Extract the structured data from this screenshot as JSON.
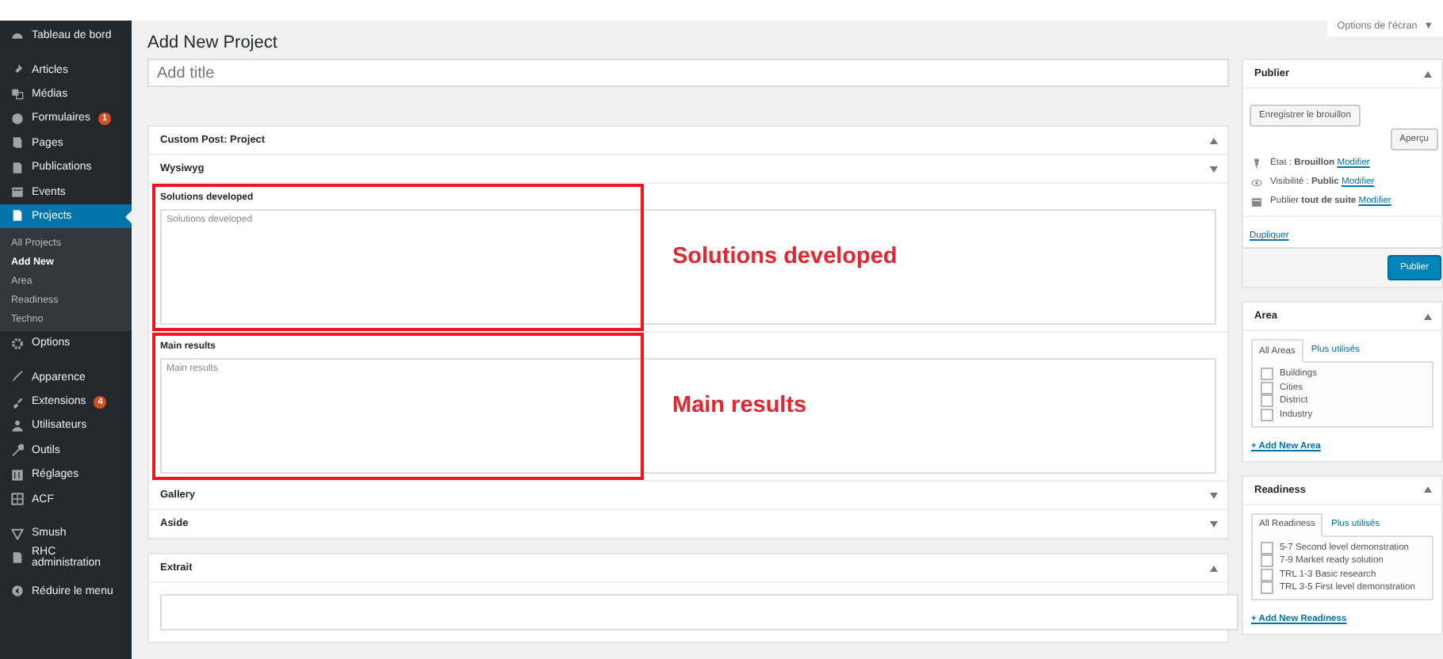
{
  "sidebar": {
    "groups": [
      [
        {
          "label": "Tableau de bord",
          "selected": false
        }
      ],
      [
        {
          "label": "Articles",
          "selected": false
        },
        {
          "label": "Médias",
          "selected": false
        },
        {
          "label": "Formulaires",
          "badge": "1",
          "selected": false
        },
        {
          "label": "Pages",
          "selected": false
        },
        {
          "label": "Publications",
          "selected": false
        },
        {
          "label": "Events",
          "selected": false
        },
        {
          "label": "Projects",
          "selected": true,
          "children": [
            {
              "label": "All Projects",
              "selected": false
            },
            {
              "label": "Add New",
              "selected": true
            },
            {
              "label": "Area",
              "selected": false
            },
            {
              "label": "Readiness",
              "selected": false
            },
            {
              "label": "Techno",
              "selected": false
            }
          ]
        },
        {
          "label": "Options",
          "selected": false
        }
      ],
      [
        {
          "label": "Apparence",
          "selected": false
        },
        {
          "label": "Extensions",
          "badge": "4",
          "selected": false
        },
        {
          "label": "Utilisateurs",
          "selected": false
        },
        {
          "label": "Outils",
          "selected": false
        },
        {
          "label": "Réglages",
          "selected": false
        },
        {
          "label": "ACF",
          "selected": false
        }
      ],
      [
        {
          "label": "Smush",
          "selected": false
        },
        {
          "label": "RHC administration",
          "selected": false
        }
      ],
      [
        {
          "label": "Réduire le menu",
          "selected": false
        }
      ]
    ]
  },
  "screen_options": {
    "label": "Options de l'écran",
    "caret": "▼"
  },
  "page_title": "Add New Project",
  "title_field": {
    "placeholder": "Add title"
  },
  "metaboxes": [
    {
      "title": "Custom Post: Project",
      "expanded": true
    },
    {
      "title": "Wysiwyg",
      "expanded": false,
      "fields": [
        {
          "label": "Solutions developed",
          "placeholder": "Solutions developed",
          "annotation": "Solutions developed"
        },
        {
          "label": "Main results",
          "placeholder": "Main results",
          "annotation": "Main results"
        }
      ]
    },
    {
      "title": "Gallery",
      "expanded": false
    },
    {
      "title": "Aside",
      "expanded": false
    }
  ],
  "excerpt": {
    "title": "Extrait",
    "expanded": true
  },
  "publish": {
    "title": "Publier",
    "expanded": true,
    "save_draft": "Enregistrer le brouillon",
    "preview": "Aperçu",
    "rows": [
      {
        "text": "État : **Brouillon**",
        "link": "Modifier"
      },
      {
        "text": "Visibilité : **Public**",
        "link": "Modifier"
      },
      {
        "text": "Publier **tout de suite**",
        "link": "Modifier"
      }
    ],
    "duplicate": "Dupliquer",
    "publish_button": "Publier"
  },
  "taxonomies": [
    {
      "title": "Area",
      "expanded": true,
      "tabs": [
        {
          "label": "All Areas",
          "selected": true
        },
        {
          "label": "Plus utilisés",
          "selected": false
        }
      ],
      "terms": [
        {
          "label": "Buildings",
          "checked": false
        },
        {
          "label": "Cities",
          "checked": false
        },
        {
          "label": "District",
          "checked": false
        },
        {
          "label": "Industry",
          "checked": false
        }
      ],
      "add_link": "+ Add New Area"
    },
    {
      "title": "Readiness",
      "expanded": true,
      "tabs": [
        {
          "label": "All Readiness",
          "selected": true
        },
        {
          "label": "Plus utilisés",
          "selected": false
        }
      ],
      "terms": [
        {
          "label": "5-7 Second level demonstration",
          "checked": false
        },
        {
          "label": "7-9 Market ready solution",
          "checked": false
        },
        {
          "label": "TRL 1-3 Basic research",
          "checked": false
        },
        {
          "label": "TRL 3-5 First level demonstration",
          "checked": false
        }
      ],
      "add_link": "+ Add New Readiness"
    }
  ]
}
